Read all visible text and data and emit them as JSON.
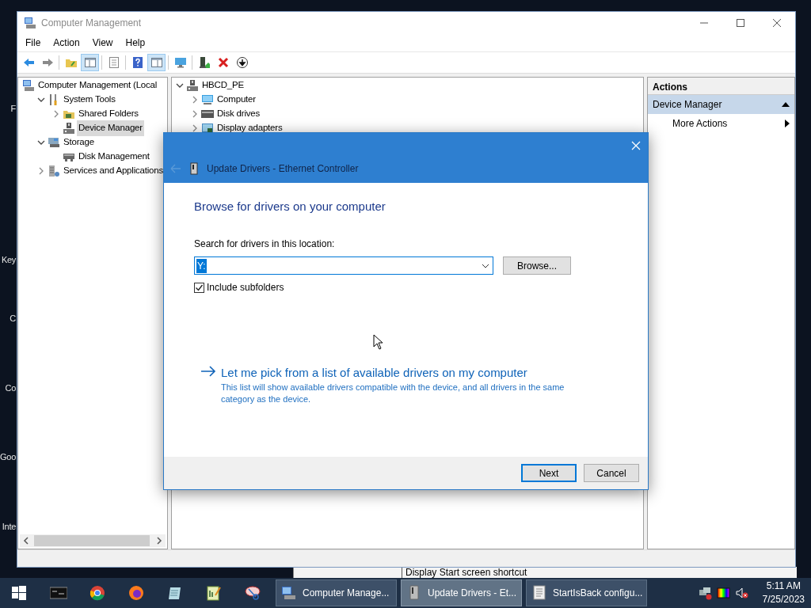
{
  "desktop": {
    "labels": [
      "F",
      "Key",
      "C",
      "Co",
      "Goo",
      "Inte"
    ]
  },
  "background_window": {
    "text": "Display Start screen shortcut"
  },
  "window": {
    "title": "Computer Management",
    "menu": [
      "File",
      "Action",
      "View",
      "Help"
    ],
    "toolbar": [
      {
        "kind": "back",
        "pressed": false
      },
      {
        "kind": "forward",
        "pressed": false
      },
      {
        "kind": "folder-up",
        "pressed": false
      },
      {
        "kind": "tree-pane",
        "pressed": true
      },
      {
        "kind": "properties",
        "pressed": false
      },
      {
        "kind": "help",
        "pressed": false
      },
      {
        "kind": "action-pane",
        "pressed": true
      },
      {
        "kind": "monitor",
        "pressed": false
      },
      {
        "kind": "update",
        "pressed": false
      },
      {
        "kind": "delete",
        "pressed": false
      },
      {
        "kind": "download",
        "pressed": false
      }
    ],
    "console_tree": [
      {
        "label": "Computer Management (Local",
        "kind": "management",
        "selected": false,
        "children": [
          {
            "label": "System Tools",
            "kind": "tools",
            "expanded": true,
            "selected": false,
            "children": [
              {
                "label": "Shared Folders",
                "kind": "shared",
                "expanded": false,
                "selected": false
              },
              {
                "label": "Device Manager",
                "kind": "device",
                "selected": true
              }
            ]
          },
          {
            "label": "Storage",
            "kind": "storage",
            "expanded": true,
            "selected": false,
            "children": [
              {
                "label": "Disk Management",
                "kind": "disk",
                "selected": false
              }
            ]
          },
          {
            "label": "Services and Applications",
            "kind": "services",
            "expanded": false,
            "selected": false
          }
        ]
      }
    ],
    "device_tree": [
      {
        "label": "HBCD_PE",
        "kind": "device",
        "expanded": true,
        "selected": false,
        "children": [
          {
            "label": "Computer",
            "kind": "monitor",
            "expanded": false,
            "selected": false
          },
          {
            "label": "Disk drives",
            "kind": "drive",
            "expanded": false,
            "selected": false
          },
          {
            "label": "Display adapters",
            "kind": "display",
            "expanded": false,
            "selected": false
          }
        ]
      }
    ],
    "actions": {
      "header": "Actions",
      "section": "Device Manager",
      "items": [
        "More Actions"
      ]
    }
  },
  "dialog": {
    "title": "Update Drivers - Ethernet Controller",
    "heading": "Browse for drivers on your computer",
    "search_label": "Search for drivers in this location:",
    "path": {
      "value": "Y:"
    },
    "browse_button": "Browse...",
    "include_subfolders": {
      "label": "Include subfolders",
      "checked": true
    },
    "pick_link": {
      "title": "Let me pick from a list of available drivers on my computer",
      "description": "This list will show available drivers compatible with the device, and all drivers in the same category as the device."
    },
    "buttons": [
      {
        "label": "Next",
        "default": true
      },
      {
        "label": "Cancel",
        "default": false
      }
    ]
  },
  "taskbar": {
    "pinned": [
      {
        "kind": "start"
      },
      {
        "kind": "terminal"
      },
      {
        "kind": "chrome"
      },
      {
        "kind": "firefox"
      },
      {
        "kind": "notepad"
      },
      {
        "kind": "notepadpp"
      },
      {
        "kind": "snip"
      }
    ],
    "tasks": [
      {
        "label": "Computer Manage...",
        "kind": "computer",
        "selected": false
      },
      {
        "label": "Update Drivers - Et...",
        "kind": "device",
        "selected": true
      },
      {
        "label": "StartIsBack configu...",
        "kind": "document",
        "selected": false
      }
    ],
    "tray": [
      {
        "kind": "network"
      },
      {
        "kind": "color"
      },
      {
        "kind": "volume"
      }
    ],
    "clock": {
      "time": "5:11 AM",
      "date": "7/25/2023"
    }
  }
}
